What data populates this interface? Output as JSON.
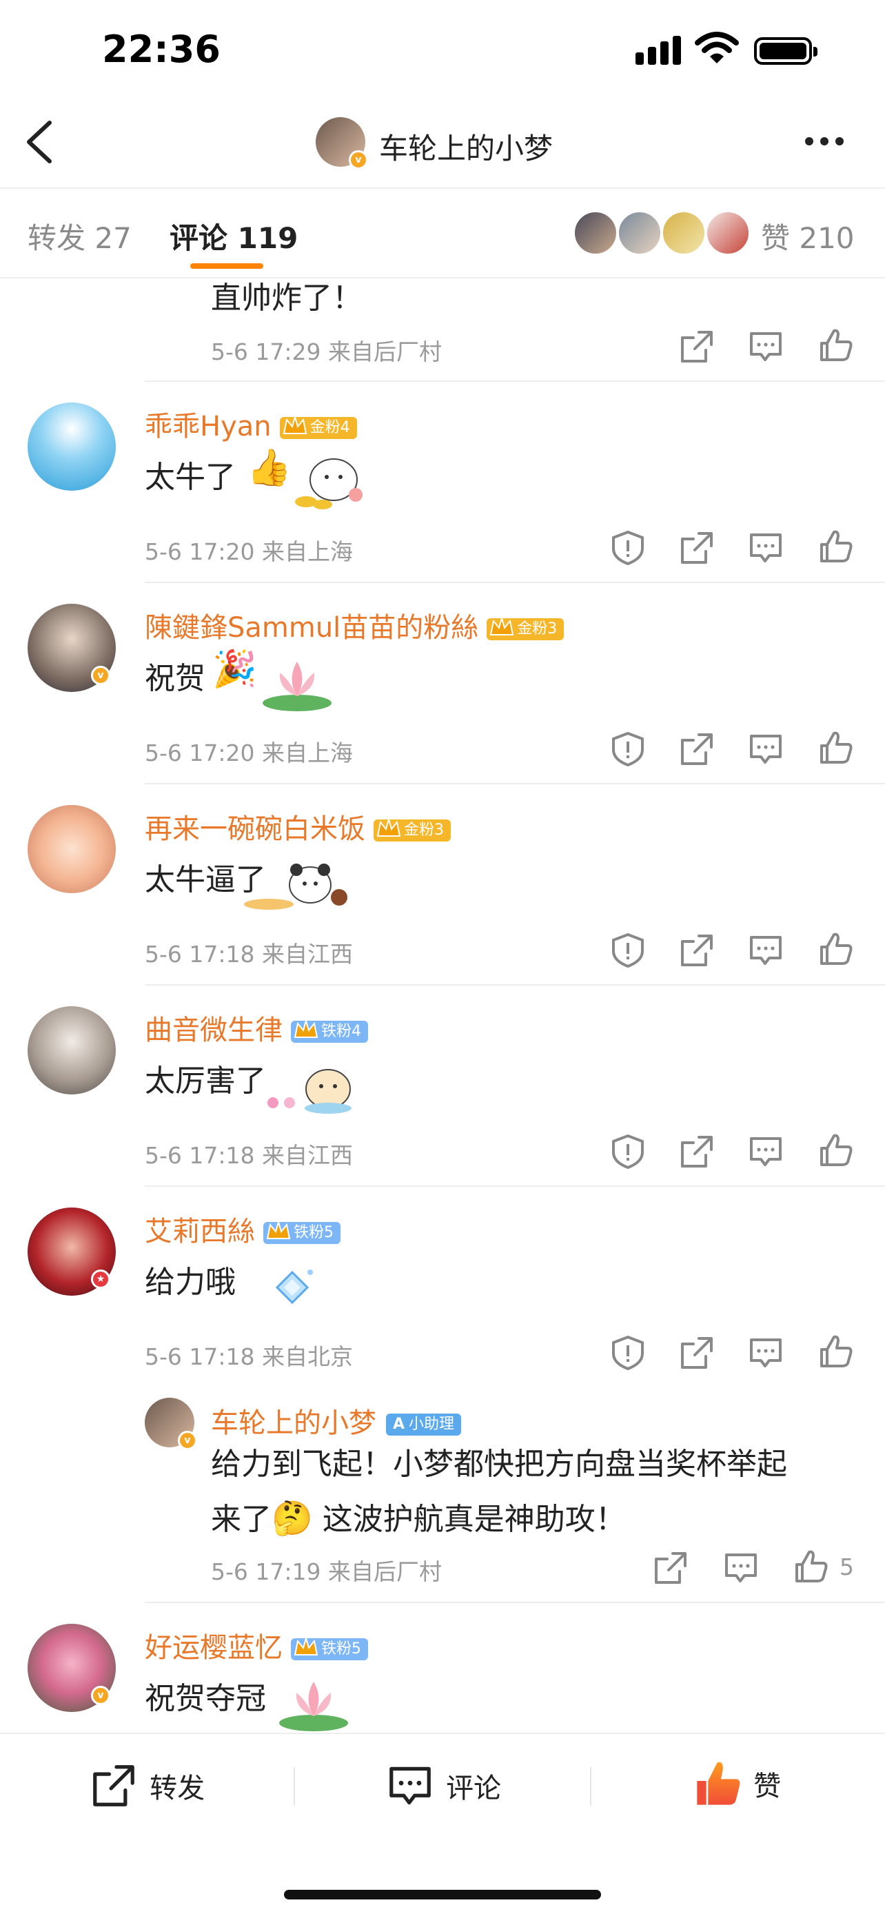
{
  "status_bar": {
    "time": "22:36"
  },
  "nav": {
    "title": "车轮上的小梦"
  },
  "tabs": {
    "repost": "转发 27",
    "comment": "评论 119",
    "like": "赞 210"
  },
  "partial_comment": {
    "text": "直帅炸了！",
    "meta": "5-6 17:29 来自后厂村"
  },
  "comments": [
    {
      "user": "乖乖Hyan",
      "badge": "金粉4",
      "text": "太牛了",
      "meta": "5-6 17:20 来自上海"
    },
    {
      "user": "陳鍵鋒Sammul苗苗的粉絲",
      "badge": "金粉3",
      "text": "祝贺",
      "meta": "5-6 17:20 来自上海"
    },
    {
      "user": "再来一碗碗白米饭",
      "badge": "金粉3",
      "text": "太牛逼了",
      "meta": "5-6 17:18 来自江西"
    },
    {
      "user": "曲音微生律",
      "badge": "铁粉4",
      "text": "太厉害了",
      "meta": "5-6 17:18 来自江西"
    },
    {
      "user": "艾莉西絲",
      "badge": "铁粉5",
      "text": "给力哦",
      "meta": "5-6 17:18 来自北京"
    },
    {
      "user": "好运樱蓝忆",
      "badge": "铁粉5",
      "text": "祝贺夺冠"
    }
  ],
  "reply": {
    "user": "车轮上的小梦",
    "badge": "小助理",
    "line1": "给力到飞起！小梦都快把方向盘当奖杯举起",
    "line2": "这波护航真是神助攻！",
    "line2_prefix": "来了",
    "meta": "5-6 17:19 来自后厂村",
    "like_count": "5"
  },
  "bottom_bar": {
    "repost": "转发",
    "comment": "评论",
    "like": "赞"
  },
  "colors": {
    "accent": "#ff8200",
    "username": "#e8792b",
    "gold_badge": "#f6b62a",
    "iron_badge": "#7cb6f6"
  }
}
